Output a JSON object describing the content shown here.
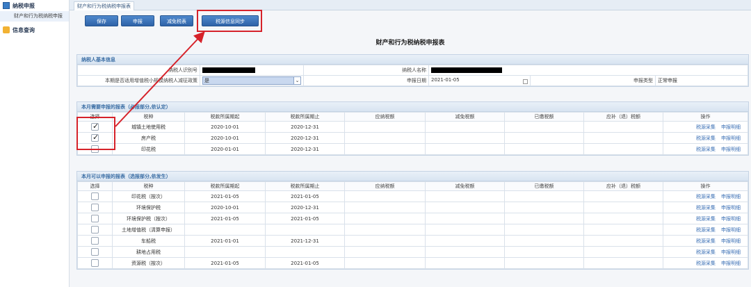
{
  "sidebar": {
    "groups": [
      {
        "label": "纳税申报",
        "icon": "tax-report-icon",
        "items": [
          {
            "label": "财产和行为税纳税申报"
          }
        ]
      },
      {
        "label": "信息查询",
        "icon": "info-query-icon",
        "items": []
      }
    ]
  },
  "tab": {
    "label": "财产和行为税纳税申报表"
  },
  "toolbar": {
    "save_label": "保存",
    "declare_label": "申报",
    "reduce_label": "减免税表",
    "sync_label": "税源信息同步"
  },
  "form_title": "财产和行为税纳税申报表",
  "basic_info": {
    "title": "纳税人基本信息",
    "taxpayer_id_label": "纳税人识别号",
    "taxpayer_name_label": "纳税人名称",
    "policy_label": "本期是否适用增值税小规模纳税人减征政策",
    "policy_value": "是",
    "declare_date_label": "申报日期",
    "declare_date_value": "2021-01-05",
    "declare_type_label": "申报类型",
    "declare_type_value": "正常申报"
  },
  "columns": [
    "选择",
    "税种",
    "税款所属期起",
    "税款所属期止",
    "应纳税额",
    "减免税额",
    "已缴税额",
    "应补（退）税额",
    "操作"
  ],
  "op_labels": {
    "collect": "税源采集",
    "detail": "申报明细"
  },
  "required_section": {
    "title": "本月需要申报的报表（必报部分,依认定）",
    "rows": [
      {
        "checked": true,
        "tax": "城镇土地使用税",
        "start": "2020-10-01",
        "end": "2020-12-31"
      },
      {
        "checked": true,
        "tax": "房产税",
        "start": "2020-10-01",
        "end": "2020-12-31"
      },
      {
        "checked": false,
        "tax": "印花税",
        "start": "2020-01-01",
        "end": "2020-12-31"
      }
    ]
  },
  "optional_section": {
    "title": "本月可以申报的报表（选报部分,依发生）",
    "rows": [
      {
        "checked": false,
        "tax": "印花税（按次）",
        "start": "2021-01-05",
        "end": "2021-01-05"
      },
      {
        "checked": false,
        "tax": "环境保护税",
        "start": "2020-10-01",
        "end": "2020-12-31"
      },
      {
        "checked": false,
        "tax": "环境保护税（按次）",
        "start": "2021-01-05",
        "end": "2021-01-05"
      },
      {
        "checked": false,
        "tax": "土地增值税（清算申报）",
        "start": "",
        "end": ""
      },
      {
        "checked": false,
        "tax": "车船税",
        "start": "2021-01-01",
        "end": "2021-12-31"
      },
      {
        "checked": false,
        "tax": "耕地占用税",
        "start": "",
        "end": ""
      },
      {
        "checked": false,
        "tax": "资源税（按次）",
        "start": "2021-01-05",
        "end": "2021-01-05"
      }
    ]
  },
  "colors": {
    "accent": "#2e63a8",
    "highlight": "#d6222a",
    "link": "#3a6fb5"
  }
}
